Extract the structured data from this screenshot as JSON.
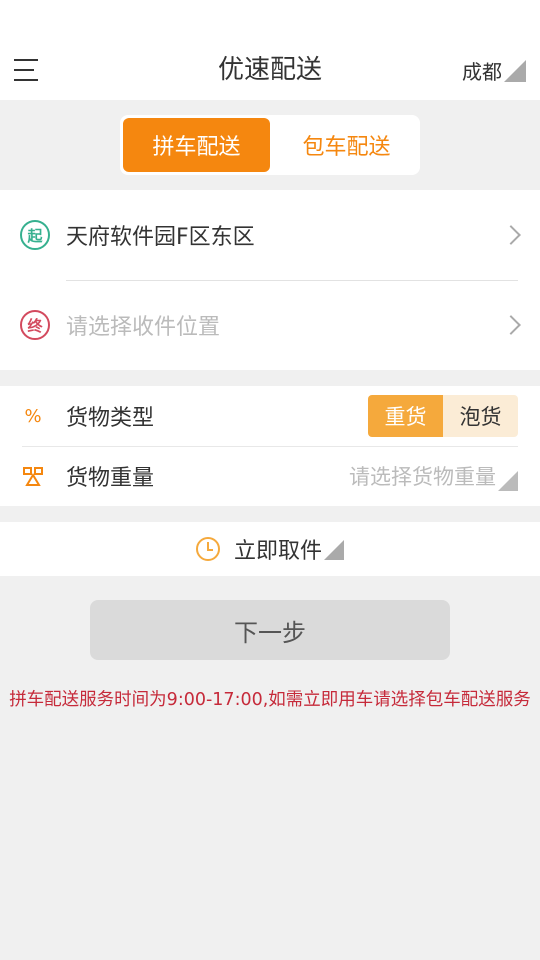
{
  "header": {
    "title": "优速配送",
    "city": "成都"
  },
  "mode_tabs": [
    {
      "label": "拼车配送",
      "active": true
    },
    {
      "label": "包车配送",
      "active": false
    }
  ],
  "address": {
    "start_badge": "起",
    "start_value": "天府软件园F区东区",
    "end_badge": "终",
    "end_placeholder": "请选择收件位置"
  },
  "cargo": {
    "type_label": "货物类型",
    "type_options": [
      {
        "label": "重货",
        "active": true
      },
      {
        "label": "泡货",
        "active": false
      }
    ],
    "weight_label": "货物重量",
    "weight_placeholder": "请选择货物重量"
  },
  "pickup": {
    "label": "立即取件"
  },
  "actions": {
    "next_label": "下一步"
  },
  "notice": "拼车配送服务时间为9:00-17:00,如需立即用车请选择包车配送服务",
  "colors": {
    "accent": "#f5870f",
    "start_green": "#36b08f",
    "end_red": "#d34a5e",
    "notice_red": "#c62a3a"
  }
}
